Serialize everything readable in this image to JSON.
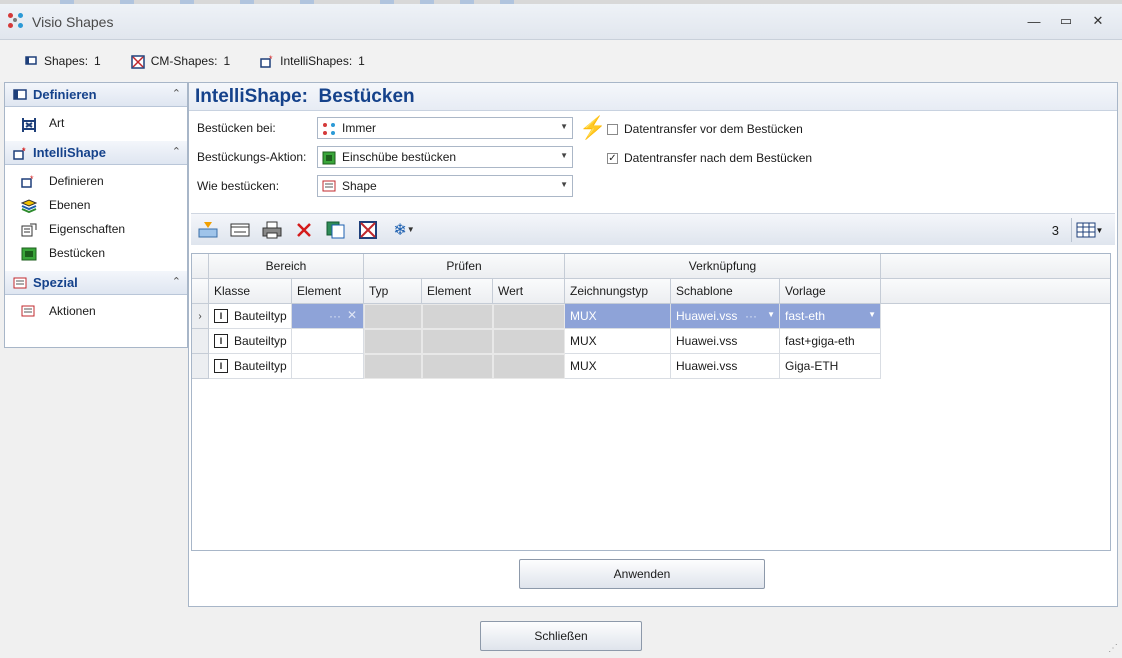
{
  "window": {
    "title": "Visio Shapes",
    "minimize": "—",
    "maximize": "▭",
    "close": "✕"
  },
  "counts": [
    {
      "label": "Shapes:",
      "value": "1",
      "icon": "shape-icon"
    },
    {
      "label": "CM-Shapes:",
      "value": "1",
      "icon": "cm-shape-icon"
    },
    {
      "label": "IntelliShapes:",
      "value": "1",
      "icon": "intellishape-icon"
    }
  ],
  "sidebar": {
    "sections": [
      {
        "title": "Definieren",
        "icon": "define-icon",
        "items": [
          {
            "label": "Art",
            "icon": "art-icon"
          }
        ]
      },
      {
        "title": "IntelliShape",
        "icon": "intellishape-icon",
        "items": [
          {
            "label": "Definieren",
            "icon": "define-icon"
          },
          {
            "label": "Ebenen",
            "icon": "layers-icon"
          },
          {
            "label": "Eigenschaften",
            "icon": "properties-icon"
          },
          {
            "label": "Bestücken",
            "icon": "populate-icon"
          }
        ]
      },
      {
        "title": "Spezial",
        "icon": "special-icon",
        "items": [
          {
            "label": "Aktionen",
            "icon": "actions-icon"
          }
        ]
      }
    ]
  },
  "main": {
    "title": "IntelliShape:  Bestücken",
    "fields": {
      "bestuecken_bei": {
        "label": "Bestücken bei:",
        "value": "Immer"
      },
      "aktion": {
        "label": "Bestückungs-Aktion:",
        "value": "Einschübe bestücken"
      },
      "wie": {
        "label": "Wie bestücken:",
        "value": "Shape"
      }
    },
    "checkboxes": {
      "vor": {
        "label": "Datentransfer vor dem Bestücken",
        "checked": false
      },
      "nach": {
        "label": "Datentransfer nach dem Bestücken",
        "checked": true,
        "mark": "✓"
      }
    },
    "toolbar": {
      "count": "3",
      "icons": [
        "filter-icon",
        "columns-icon",
        "print-icon",
        "delete-icon",
        "copy-icon",
        "cm-shape-icon",
        "snowflake-icon"
      ]
    },
    "grid": {
      "groups": [
        "Bereich",
        "Prüfen",
        "Verknüpfung"
      ],
      "columns": [
        "Klasse",
        "Element",
        "Typ",
        "Element",
        "Wert",
        "Zeichnungstyp",
        "Schablone",
        "Vorlage"
      ],
      "rows": [
        {
          "indicator": "›",
          "klasse": "Bauteiltyp",
          "element": "",
          "typ": "",
          "p_element": "",
          "wert": "",
          "zeichnungstyp": "MUX",
          "schablone": "Huawei.vss",
          "vorlage": "fast-eth",
          "selected": true
        },
        {
          "indicator": "",
          "klasse": "Bauteiltyp",
          "element": "",
          "typ": "",
          "p_element": "",
          "wert": "",
          "zeichnungstyp": "MUX",
          "schablone": "Huawei.vss",
          "vorlage": "fast+giga-eth",
          "selected": false
        },
        {
          "indicator": "",
          "klasse": "Bauteiltyp",
          "element": "",
          "typ": "",
          "p_element": "",
          "wert": "",
          "zeichnungstyp": "MUX",
          "schablone": "Huawei.vss",
          "vorlage": "Giga-ETH",
          "selected": false
        }
      ],
      "cell_ellipsis": "···",
      "cell_clear": "✕"
    },
    "apply_button": "Anwenden"
  },
  "close_button": "Schließen"
}
